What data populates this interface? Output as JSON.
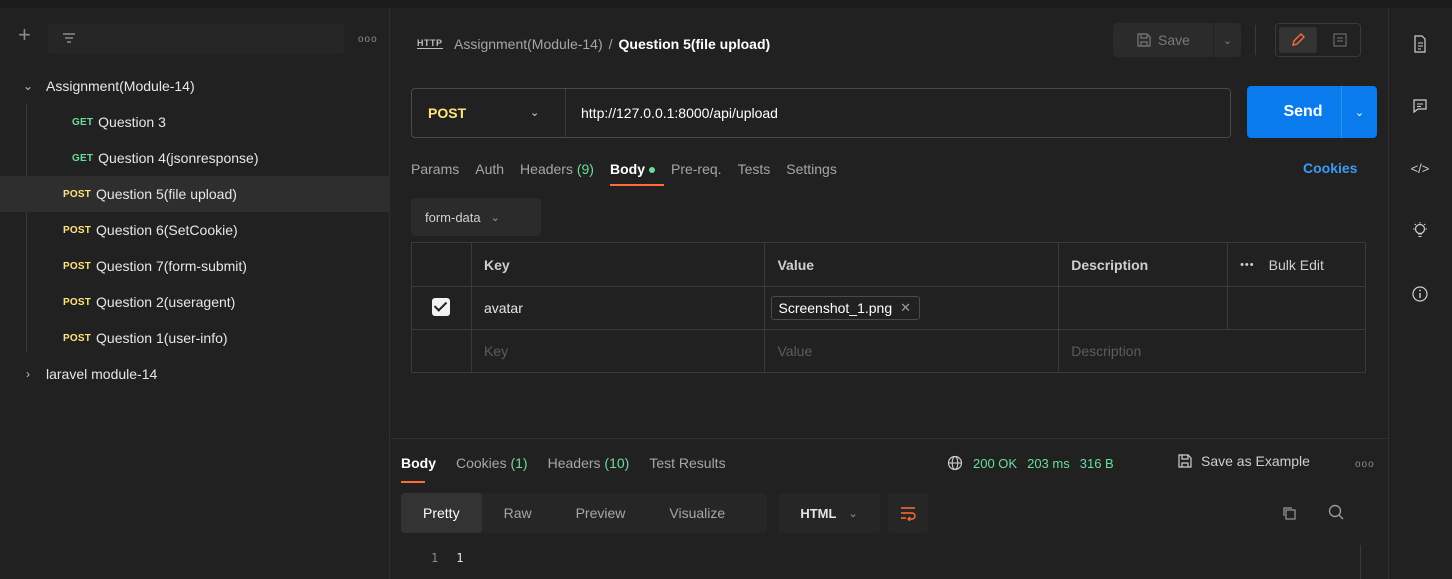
{
  "sidebar": {
    "tree": [
      {
        "type": "folder",
        "expanded": true,
        "label": "Assignment(Module-14)"
      },
      {
        "type": "request",
        "method": "GET",
        "label": "Question 3"
      },
      {
        "type": "request",
        "method": "GET",
        "label": "Question 4(jsonresponse)"
      },
      {
        "type": "request",
        "method": "POST",
        "label": "Question 5(file upload)",
        "selected": true
      },
      {
        "type": "request",
        "method": "POST",
        "label": "Question 6(SetCookie)"
      },
      {
        "type": "request",
        "method": "POST",
        "label": "Question 7(form-submit)"
      },
      {
        "type": "request",
        "method": "POST",
        "label": "Question 2(useragent)"
      },
      {
        "type": "request",
        "method": "POST",
        "label": "Question 1(user-info)"
      },
      {
        "type": "folder",
        "expanded": false,
        "label": "laravel module-14"
      }
    ]
  },
  "header": {
    "icon_label": "HTTP",
    "breadcrumb_parent": "Assignment(Module-14)",
    "breadcrumb_sep": "/",
    "breadcrumb_current": "Question 5(file upload)",
    "save_label": "Save"
  },
  "request": {
    "method": "POST",
    "url": "http://127.0.0.1:8000/api/upload",
    "send_label": "Send"
  },
  "tabs": {
    "params": "Params",
    "auth": "Auth",
    "headers": "Headers",
    "headers_count": "(9)",
    "body": "Body",
    "prereq": "Pre-req.",
    "tests": "Tests",
    "settings": "Settings",
    "cookies": "Cookies"
  },
  "body": {
    "mode": "form-data",
    "table": {
      "headers": {
        "key": "Key",
        "value": "Value",
        "description": "Description",
        "bulk_edit": "Bulk Edit"
      },
      "rows": [
        {
          "checked": true,
          "key": "avatar",
          "value": "Screenshot_1.png",
          "description": ""
        }
      ],
      "placeholders": {
        "key": "Key",
        "value": "Value",
        "description": "Description"
      }
    }
  },
  "response": {
    "tabs": {
      "body": "Body",
      "cookies": "Cookies",
      "cookies_count": "(1)",
      "headers": "Headers",
      "headers_count": "(10)",
      "test_results": "Test Results"
    },
    "status": "200 OK",
    "time": "203 ms",
    "size": "316 B",
    "save_example": "Save as Example",
    "views": [
      "Pretty",
      "Raw",
      "Preview",
      "Visualize"
    ],
    "active_view": "Pretty",
    "language": "HTML",
    "lines": [
      {
        "num": "1",
        "text": "1"
      }
    ]
  },
  "colors": {
    "accent_send": "#097bed",
    "get_method": "#6bdd9a",
    "post_method": "#ffe47e",
    "active_tab_underline": "#ff6c37",
    "status_ok": "#6bdd9a"
  }
}
